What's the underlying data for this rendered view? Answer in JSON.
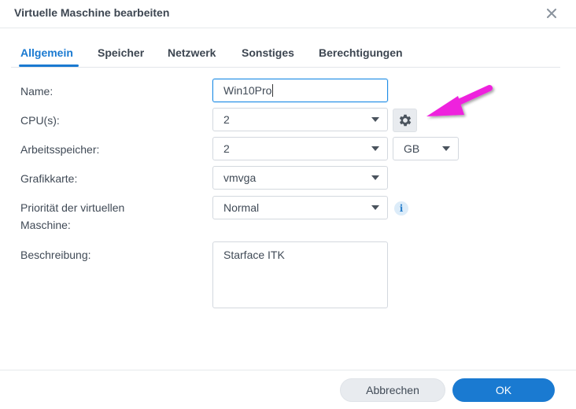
{
  "dialog": {
    "title": "Virtuelle Maschine bearbeiten"
  },
  "tabs": [
    {
      "label": "Allgemein",
      "active": true
    },
    {
      "label": "Speicher",
      "active": false
    },
    {
      "label": "Netzwerk",
      "active": false
    },
    {
      "label": "Sonstiges",
      "active": false
    },
    {
      "label": "Berechtigungen",
      "active": false
    }
  ],
  "form": {
    "name": {
      "label": "Name:",
      "value": "Win10Pro"
    },
    "cpu": {
      "label": "CPU(s):",
      "value": "2"
    },
    "memory": {
      "label": "Arbeitsspeicher:",
      "value": "2",
      "unit": "GB"
    },
    "graphics": {
      "label": "Grafikkarte:",
      "value": "vmvga"
    },
    "priority": {
      "label_line1": "Priorität der virtuellen",
      "label_line2": "Maschine:",
      "value": "Normal"
    },
    "description": {
      "label": "Beschreibung:",
      "value": "Starface ITK"
    }
  },
  "buttons": {
    "cancel": "Abbrechen",
    "ok": "OK"
  },
  "colors": {
    "accent": "#1a7ad1",
    "annotation_arrow": "#ee22dd"
  },
  "icons": {
    "close": "close-icon",
    "gear": "gear-icon",
    "info": "info-icon",
    "dropdown": "chevron-down-icon"
  }
}
